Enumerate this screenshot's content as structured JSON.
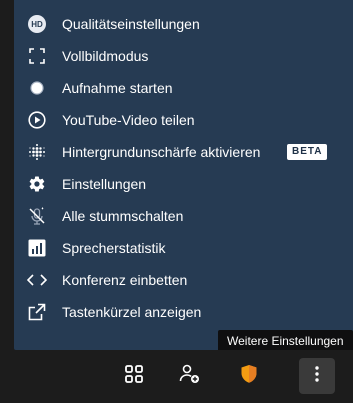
{
  "menu": {
    "items": [
      {
        "label": "Qualitätseinstellungen",
        "icon": "hd-quality-icon"
      },
      {
        "label": "Vollbildmodus",
        "icon": "fullscreen-icon"
      },
      {
        "label": "Aufnahme starten",
        "icon": "record-icon"
      },
      {
        "label": "YouTube-Video teilen",
        "icon": "play-circle-icon"
      },
      {
        "label": "Hintergrundunschärfe aktivieren",
        "icon": "blur-icon",
        "badge": "BETA"
      },
      {
        "label": "Einstellungen",
        "icon": "gear-icon"
      },
      {
        "label": "Alle stummschalten",
        "icon": "mic-off-icon"
      },
      {
        "label": "Sprecherstatistik",
        "icon": "bar-chart-icon"
      },
      {
        "label": "Konferenz einbetten",
        "icon": "code-icon"
      },
      {
        "label": "Tastenkürzel anzeigen",
        "icon": "open-external-icon"
      }
    ],
    "hd_icon_text": "HD"
  },
  "tooltip": {
    "text": "Weitere Einstellungen"
  },
  "toolbar": {
    "buttons": [
      "tile-view-icon",
      "invite-people-icon",
      "security-shield-icon",
      "more-options-icon"
    ]
  },
  "colors": {
    "menu_bg": "#263b53",
    "toolbar_bg": "#1c1c1c",
    "shield": "#f39c12",
    "tooltip_bg": "#0f0f10"
  }
}
